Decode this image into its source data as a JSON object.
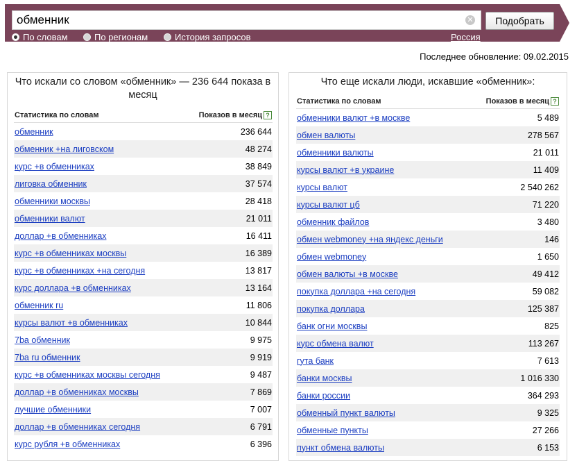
{
  "search": {
    "query": "обменник",
    "clear_icon": "close-icon",
    "submit_label": "Подобрать"
  },
  "modes": [
    {
      "label": "По словам",
      "checked": true
    },
    {
      "label": "По регионам",
      "checked": false
    },
    {
      "label": "История запросов",
      "checked": false
    }
  ],
  "region": "Россия",
  "updated": "Последнее обновление: 09.02.2015",
  "left_panel": {
    "title": "Что искали со словом «обменник» — 236 644 показа в месяц",
    "col_words": "Статистика по словам",
    "col_shows": "Показов в месяц",
    "help_icon": "?",
    "rows": [
      {
        "phrase": "обменник",
        "count": "236 644"
      },
      {
        "phrase": "обменник +на лиговском",
        "count": "48 274"
      },
      {
        "phrase": "курс +в обменниках",
        "count": "38 849"
      },
      {
        "phrase": "лиговка обменник",
        "count": "37 574"
      },
      {
        "phrase": "обменники москвы",
        "count": "28 418"
      },
      {
        "phrase": "обменники валют",
        "count": "21 011"
      },
      {
        "phrase": "доллар +в обменниках",
        "count": "16 411"
      },
      {
        "phrase": "курс +в обменниках москвы",
        "count": "16 389"
      },
      {
        "phrase": "курс +в обменниках +на сегодня",
        "count": "13 817"
      },
      {
        "phrase": "курс доллара +в обменниках",
        "count": "13 164"
      },
      {
        "phrase": "обменник ru",
        "count": "11 806"
      },
      {
        "phrase": "курсы валют +в обменниках",
        "count": "10 844"
      },
      {
        "phrase": "7ba обменник",
        "count": "9 975"
      },
      {
        "phrase": "7ba ru обменник",
        "count": "9 919"
      },
      {
        "phrase": "курс +в обменниках москвы сегодня",
        "count": "9 487"
      },
      {
        "phrase": "доллар +в обменниках москвы",
        "count": "7 869"
      },
      {
        "phrase": "лучшие обменники",
        "count": "7 007"
      },
      {
        "phrase": "доллар +в обменниках сегодня",
        "count": "6 791"
      },
      {
        "phrase": "курс рубля +в обменниках",
        "count": "6 396"
      }
    ]
  },
  "right_panel": {
    "title": "Что еще искали люди, искавшие «обменник»:",
    "col_words": "Статистика по словам",
    "col_shows": "Показов в месяц",
    "help_icon": "?",
    "rows": [
      {
        "phrase": "обменники валют +в москве",
        "count": "5 489"
      },
      {
        "phrase": "обмен валюты",
        "count": "278 567"
      },
      {
        "phrase": "обменники валюты",
        "count": "21 011"
      },
      {
        "phrase": "курсы валют +в украине",
        "count": "11 409"
      },
      {
        "phrase": "курсы валют",
        "count": "2 540 262"
      },
      {
        "phrase": "курсы валют цб",
        "count": "71 220"
      },
      {
        "phrase": "обменник файлов",
        "count": "3 480"
      },
      {
        "phrase": "обмен webmoney +на яндекс деньги",
        "count": "146"
      },
      {
        "phrase": "обмен webmoney",
        "count": "1 650"
      },
      {
        "phrase": "обмен валюты +в москве",
        "count": "49 412"
      },
      {
        "phrase": "покупка доллара +на сегодня",
        "count": "59 082"
      },
      {
        "phrase": "покупка доллара",
        "count": "125 387"
      },
      {
        "phrase": "банк огни москвы",
        "count": "825"
      },
      {
        "phrase": "курс обмена валют",
        "count": "113 267"
      },
      {
        "phrase": "гута банк",
        "count": "7 613"
      },
      {
        "phrase": "банки москвы",
        "count": "1 016 330"
      },
      {
        "phrase": "банки россии",
        "count": "364 293"
      },
      {
        "phrase": "обменный пункт валюты",
        "count": "9 325"
      },
      {
        "phrase": "обменные пункты",
        "count": "27 266"
      },
      {
        "phrase": "пункт обмена валюты",
        "count": "6 153"
      }
    ]
  }
}
